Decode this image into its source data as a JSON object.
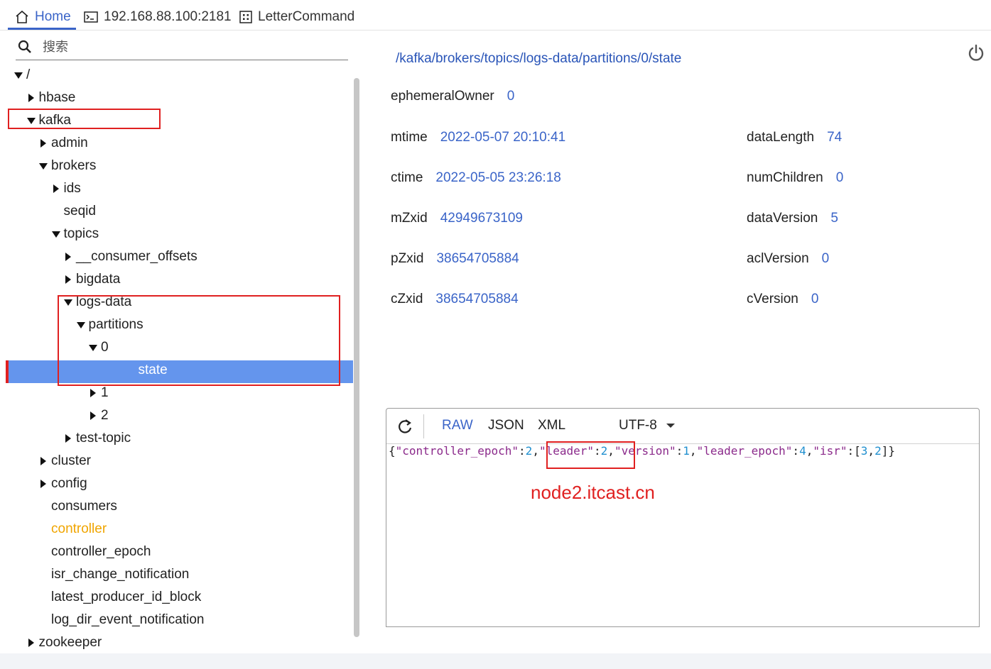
{
  "tabs": [
    {
      "label": "Home",
      "icon": "home-icon",
      "active": true
    },
    {
      "label": "192.168.88.100:2181",
      "icon": "terminal-icon",
      "active": false
    },
    {
      "label": "LetterCommand",
      "icon": "command-icon",
      "active": false
    }
  ],
  "search": {
    "placeholder": "搜索"
  },
  "tree": [
    {
      "label": "/",
      "expanded": true
    },
    {
      "label": "hbase",
      "expanded": false
    },
    {
      "label": "kafka",
      "expanded": true
    },
    {
      "label": "admin",
      "expanded": false
    },
    {
      "label": "brokers",
      "expanded": true
    },
    {
      "label": "ids",
      "expanded": false
    },
    {
      "label": "seqid",
      "leaf": true
    },
    {
      "label": "topics",
      "expanded": true
    },
    {
      "label": "__consumer_offsets",
      "expanded": false
    },
    {
      "label": "bigdata",
      "expanded": false
    },
    {
      "label": "logs-data",
      "expanded": true
    },
    {
      "label": "partitions",
      "expanded": true
    },
    {
      "label": "0",
      "expanded": true
    },
    {
      "label": "state",
      "leaf": true,
      "selected": true
    },
    {
      "label": "1",
      "expanded": false
    },
    {
      "label": "2",
      "expanded": false
    },
    {
      "label": "test-topic",
      "expanded": false
    },
    {
      "label": "cluster",
      "expanded": false
    },
    {
      "label": "config",
      "expanded": false
    },
    {
      "label": "consumers",
      "leaf": true
    },
    {
      "label": "controller",
      "leaf": true,
      "highlight_color": "#f0a500"
    },
    {
      "label": "controller_epoch",
      "leaf": true
    },
    {
      "label": "isr_change_notification",
      "leaf": true
    },
    {
      "label": "latest_producer_id_block",
      "leaf": true
    },
    {
      "label": "log_dir_event_notification",
      "leaf": true
    },
    {
      "label": "zookeeper",
      "expanded": false
    }
  ],
  "node_path": "/kafka/brokers/topics/logs-data/partitions/0/state",
  "stats": {
    "ephemeralOwner": {
      "label": "ephemeralOwner",
      "value": "0"
    },
    "mtime": {
      "label": "mtime",
      "value": "2022-05-07 20:10:41"
    },
    "ctime": {
      "label": "ctime",
      "value": "2022-05-05 23:26:18"
    },
    "mZxid": {
      "label": "mZxid",
      "value": "42949673109"
    },
    "pZxid": {
      "label": "pZxid",
      "value": "38654705884"
    },
    "cZxid": {
      "label": "cZxid",
      "value": "38654705884"
    },
    "dataLength": {
      "label": "dataLength",
      "value": "74"
    },
    "numChildren": {
      "label": "numChildren",
      "value": "0"
    },
    "dataVersion": {
      "label": "dataVersion",
      "value": "5"
    },
    "aclVersion": {
      "label": "aclVersion",
      "value": "0"
    },
    "cVersion": {
      "label": "cVersion",
      "value": "0"
    }
  },
  "editor": {
    "formats": {
      "raw": "RAW",
      "json": "JSON",
      "xml": "XML"
    },
    "active_format": "RAW",
    "encoding": "UTF-8",
    "content": [
      {
        "t": "{",
        "c": "p"
      },
      {
        "t": "\"controller_epoch\"",
        "c": "s"
      },
      {
        "t": ":",
        "c": "p"
      },
      {
        "t": "2",
        "c": "n"
      },
      {
        "t": ",",
        "c": "p"
      },
      {
        "t": "\"leader\"",
        "c": "s"
      },
      {
        "t": ":",
        "c": "p"
      },
      {
        "t": "2",
        "c": "n"
      },
      {
        "t": ",",
        "c": "p"
      },
      {
        "t": "\"version\"",
        "c": "s"
      },
      {
        "t": ":",
        "c": "p"
      },
      {
        "t": "1",
        "c": "n"
      },
      {
        "t": ",",
        "c": "p"
      },
      {
        "t": "\"leader_epoch\"",
        "c": "s"
      },
      {
        "t": ":",
        "c": "p"
      },
      {
        "t": "4",
        "c": "n"
      },
      {
        "t": ",",
        "c": "p"
      },
      {
        "t": "\"isr\"",
        "c": "s"
      },
      {
        "t": ":[",
        "c": "p"
      },
      {
        "t": "3",
        "c": "n"
      },
      {
        "t": ",",
        "c": "p"
      },
      {
        "t": "2",
        "c": "n"
      },
      {
        "t": "]}",
        "c": "p"
      }
    ]
  },
  "annotation": "node2.itcast.cn",
  "colors": {
    "accent": "#3a64c8",
    "selection": "#6495ed",
    "annotation_red": "#e02020"
  }
}
